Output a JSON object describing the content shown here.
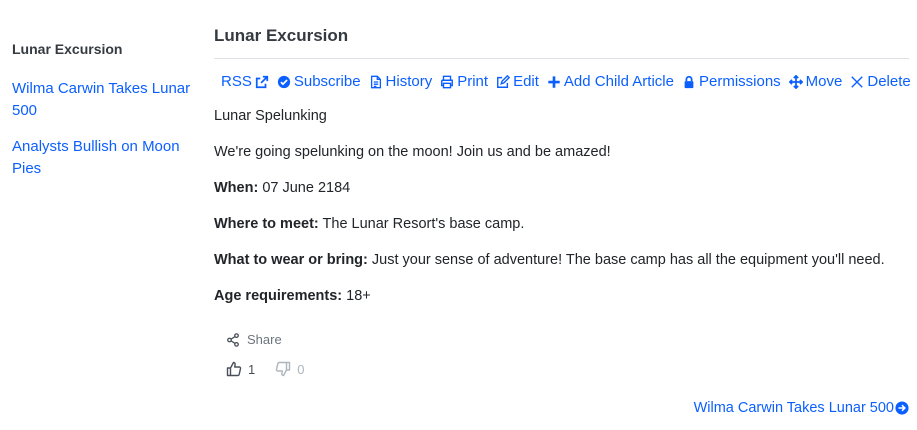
{
  "sidebar": {
    "title": "Lunar Excursion",
    "links": [
      "Wilma Carwin Takes Lunar 500",
      "Analysts Bullish on Moon Pies"
    ]
  },
  "article": {
    "title": "Lunar Excursion",
    "toolbar": {
      "rss": "RSS",
      "subscribe": "Subscribe",
      "history": "History",
      "print": "Print",
      "edit": "Edit",
      "add_child": "Add Child Article",
      "permissions": "Permissions",
      "move": "Move",
      "delete": "Delete"
    },
    "heading_line": "Lunar Spelunking",
    "intro": "We're going spelunking on the moon! Join us and be amazed!",
    "fields": [
      {
        "label": "When:",
        "value": "07 June 2184"
      },
      {
        "label": "Where to meet:",
        "value": "The Lunar Resort's base camp."
      },
      {
        "label": "What to wear or bring:",
        "value": "Just your sense of adventure! The base camp has all the equipment you'll need."
      },
      {
        "label": "Age requirements:",
        "value": "18+"
      }
    ],
    "share_label": "Share",
    "thumbs_up": "1",
    "thumbs_down": "0"
  },
  "next_link": "Wilma Carwin Takes Lunar 500",
  "colors": {
    "link": "#0b5fff",
    "text": "#212529",
    "muted": "#6c757d",
    "divider": "#dee2e6"
  }
}
